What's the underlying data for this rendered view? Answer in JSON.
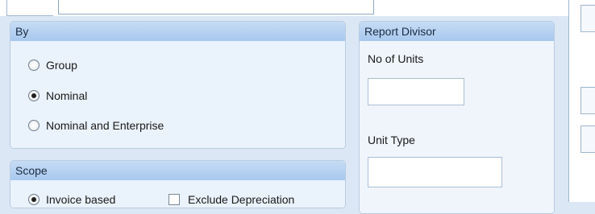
{
  "by_group": {
    "title": "By",
    "options": [
      {
        "label": "Group",
        "checked": false
      },
      {
        "label": "Nominal",
        "checked": true
      },
      {
        "label": "Nominal and Enterprise",
        "checked": false
      }
    ]
  },
  "scope_group": {
    "title": "Scope",
    "invoice_label": "Invoice based",
    "exclude_label": "Exclude Depreciation"
  },
  "report_divisor": {
    "title": "Report Divisor",
    "units_label": "No of Units",
    "units_value": "",
    "unit_type_label": "Unit Type",
    "unit_type_value": ""
  }
}
